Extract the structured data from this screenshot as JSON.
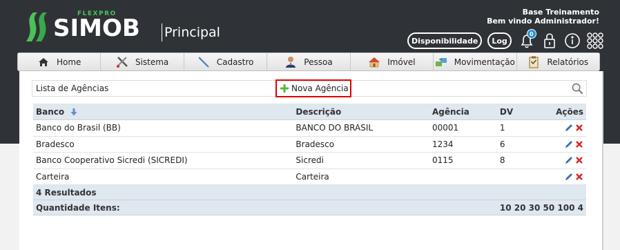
{
  "brand": {
    "company": "FLEXPRO",
    "product": "SIMOB",
    "module": "Principal"
  },
  "user": {
    "line1": "Base Treinamento",
    "line2": "Bem vindo Administrador!"
  },
  "topbar": {
    "disponibilidade": "Disponibilidade",
    "log": "Log",
    "notifications_count": "0",
    "icons": [
      "bell-icon",
      "lock-icon",
      "info-icon",
      "apps-grid-icon"
    ]
  },
  "nav": [
    {
      "label": "Home",
      "icon": "home-icon"
    },
    {
      "label": "Sistema",
      "icon": "tools-icon"
    },
    {
      "label": "Cadastro",
      "icon": "pen-icon"
    },
    {
      "label": "Pessoa",
      "icon": "person-icon"
    },
    {
      "label": "Imóvel",
      "icon": "house-icon"
    },
    {
      "label": "Movimentação",
      "icon": "transfer-icon"
    },
    {
      "label": "Relatórios",
      "icon": "clipboard-icon"
    }
  ],
  "list": {
    "title": "Lista de Agências",
    "new_button": "Nova Agência"
  },
  "table": {
    "headers": {
      "banco": "Banco",
      "descricao": "Descrição",
      "agencia": "Agência",
      "dv": "DV",
      "acoes": "Ações"
    },
    "rows": [
      {
        "banco": "Banco do Brasil (BB)",
        "descricao": "BANCO DO BRASIL",
        "agencia": "00001",
        "dv": "1"
      },
      {
        "banco": "Bradesco",
        "descricao": "Bradesco",
        "agencia": "1234",
        "dv": "6"
      },
      {
        "banco": "Banco Cooperativo Sicredi (SICREDI)",
        "descricao": "Sicredi",
        "agencia": "0115",
        "dv": "8"
      },
      {
        "banco": "Carteira",
        "descricao": "Carteira",
        "agencia": "",
        "dv": ""
      }
    ],
    "results": "4 Resultados",
    "quantity_label": "Quantidade Itens:",
    "page_sizes": "10 20 30 50 100 4"
  },
  "colors": {
    "header_bg": "#2f3337",
    "brand_green": "#4cc15a",
    "highlight_red": "#e00000",
    "edit_blue": "#3a6fb0",
    "delete_red": "#d22"
  }
}
